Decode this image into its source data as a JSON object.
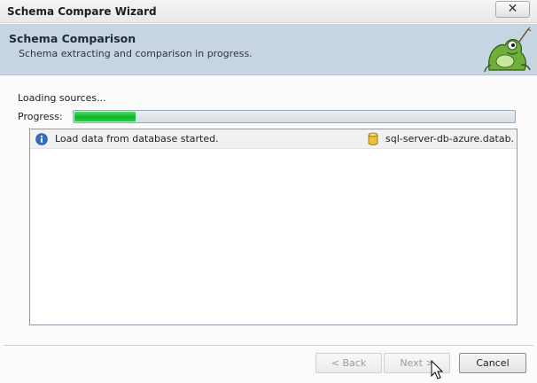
{
  "window": {
    "title": "Schema Compare Wizard",
    "close_label": "✕"
  },
  "header": {
    "title": "Schema Comparison",
    "subtitle": "Schema extracting and comparison in progress."
  },
  "status": {
    "loading_text": "Loading sources...",
    "progress_label": "Progress:",
    "progress_fraction": 0.14
  },
  "log": {
    "entries": [
      {
        "icon": "info-icon",
        "message": "Load data from database started.",
        "source_icon": "database-icon",
        "source": "sql-server-db-azure.datab..."
      }
    ]
  },
  "buttons": {
    "back_label": "< Back",
    "next_label": "Next >",
    "cancel_label": "Cancel"
  },
  "colors": {
    "header_band": "#c7d5e2",
    "progress_green": "#0cb32a",
    "info_blue": "#2f6fc0",
    "db_yellow": "#e8c23a"
  }
}
